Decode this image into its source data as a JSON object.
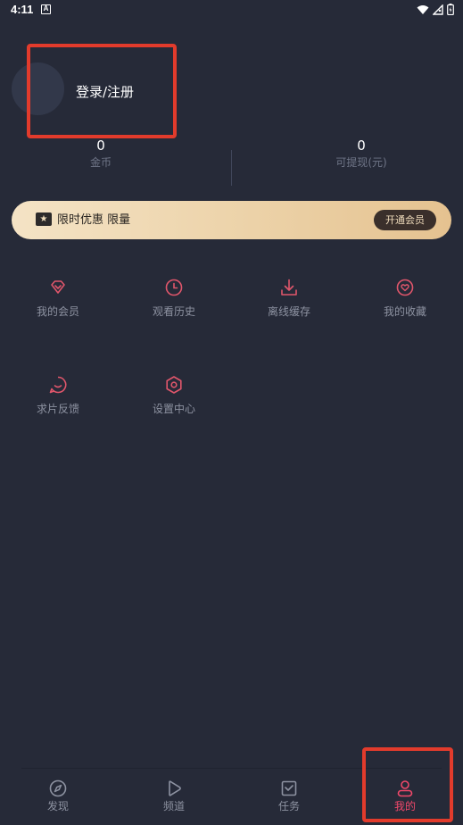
{
  "status_bar": {
    "time": "4:11",
    "notification_badge": "A"
  },
  "profile": {
    "login_label": "登录/注册"
  },
  "stats": [
    {
      "value": "0",
      "label": "金币"
    },
    {
      "value": "0",
      "label": "可提现(元)"
    }
  ],
  "vip_banner": {
    "text": "限时优惠 限量",
    "button_label": "开通会员"
  },
  "menu": [
    {
      "label": "我的会员",
      "icon": "diamond-icon"
    },
    {
      "label": "观看历史",
      "icon": "clock-icon"
    },
    {
      "label": "离线缓存",
      "icon": "download-icon"
    },
    {
      "label": "我的收藏",
      "icon": "heart-icon"
    },
    {
      "label": "求片反馈",
      "icon": "feedback-icon"
    },
    {
      "label": "设置中心",
      "icon": "settings-icon"
    }
  ],
  "bottom_nav": [
    {
      "label": "发现",
      "icon": "compass-icon",
      "active": false
    },
    {
      "label": "频道",
      "icon": "play-icon",
      "active": false
    },
    {
      "label": "任务",
      "icon": "task-icon",
      "active": false
    },
    {
      "label": "我的",
      "icon": "user-icon",
      "active": true
    }
  ],
  "colors": {
    "background": "#262a38",
    "accent": "#f0486a",
    "menu_icon": "#e0566b",
    "vip_gold": "#ecd2a8",
    "highlight_box": "#e23b2c"
  }
}
